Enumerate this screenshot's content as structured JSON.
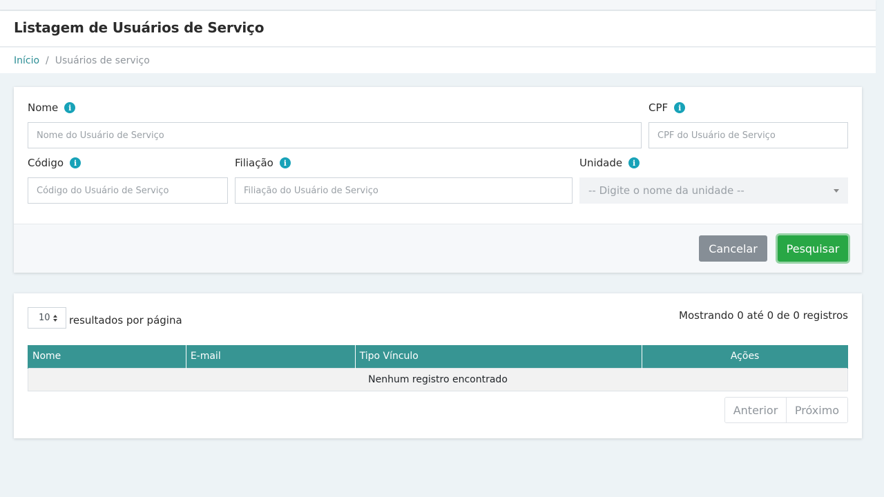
{
  "header": {
    "title": "Listagem de Usuários de Serviço"
  },
  "breadcrumb": {
    "home": "Início",
    "separator": "/",
    "current": "Usuários de serviço"
  },
  "filters": {
    "nome": {
      "label": "Nome",
      "placeholder": "Nome do Usuário de Serviço",
      "value": ""
    },
    "cpf": {
      "label": "CPF",
      "placeholder": "CPF do Usuário de Serviço",
      "value": ""
    },
    "codigo": {
      "label": "Código",
      "placeholder": "Código do Usuário de Serviço",
      "value": ""
    },
    "filiacao": {
      "label": "Filiação",
      "placeholder": "Filiação do Usuário de Serviço",
      "value": ""
    },
    "unidade": {
      "label": "Unidade",
      "placeholder": "-- Digite o nome da unidade --"
    },
    "info_icon": "i",
    "cancel_label": "Cancelar",
    "search_label": "Pesquisar"
  },
  "results": {
    "page_length": "10",
    "page_length_label": "resultados por página",
    "info": "Mostrando 0 até 0 de 0 registros",
    "columns": [
      "Nome",
      "E-mail",
      "Tipo Vínculo",
      "Ações"
    ],
    "empty_message": "Nenhum registro encontrado",
    "prev_label": "Anterior",
    "next_label": "Próximo"
  },
  "colors": {
    "accent": "#379593",
    "link": "#2c8e95",
    "info_icon": "#17a2b8",
    "primary_button": "#28a745",
    "secondary_button": "#868e96"
  },
  "icons": {
    "info": "info-circle-icon",
    "select_caret": "caret-down-icon",
    "sort": "sort-icon"
  }
}
